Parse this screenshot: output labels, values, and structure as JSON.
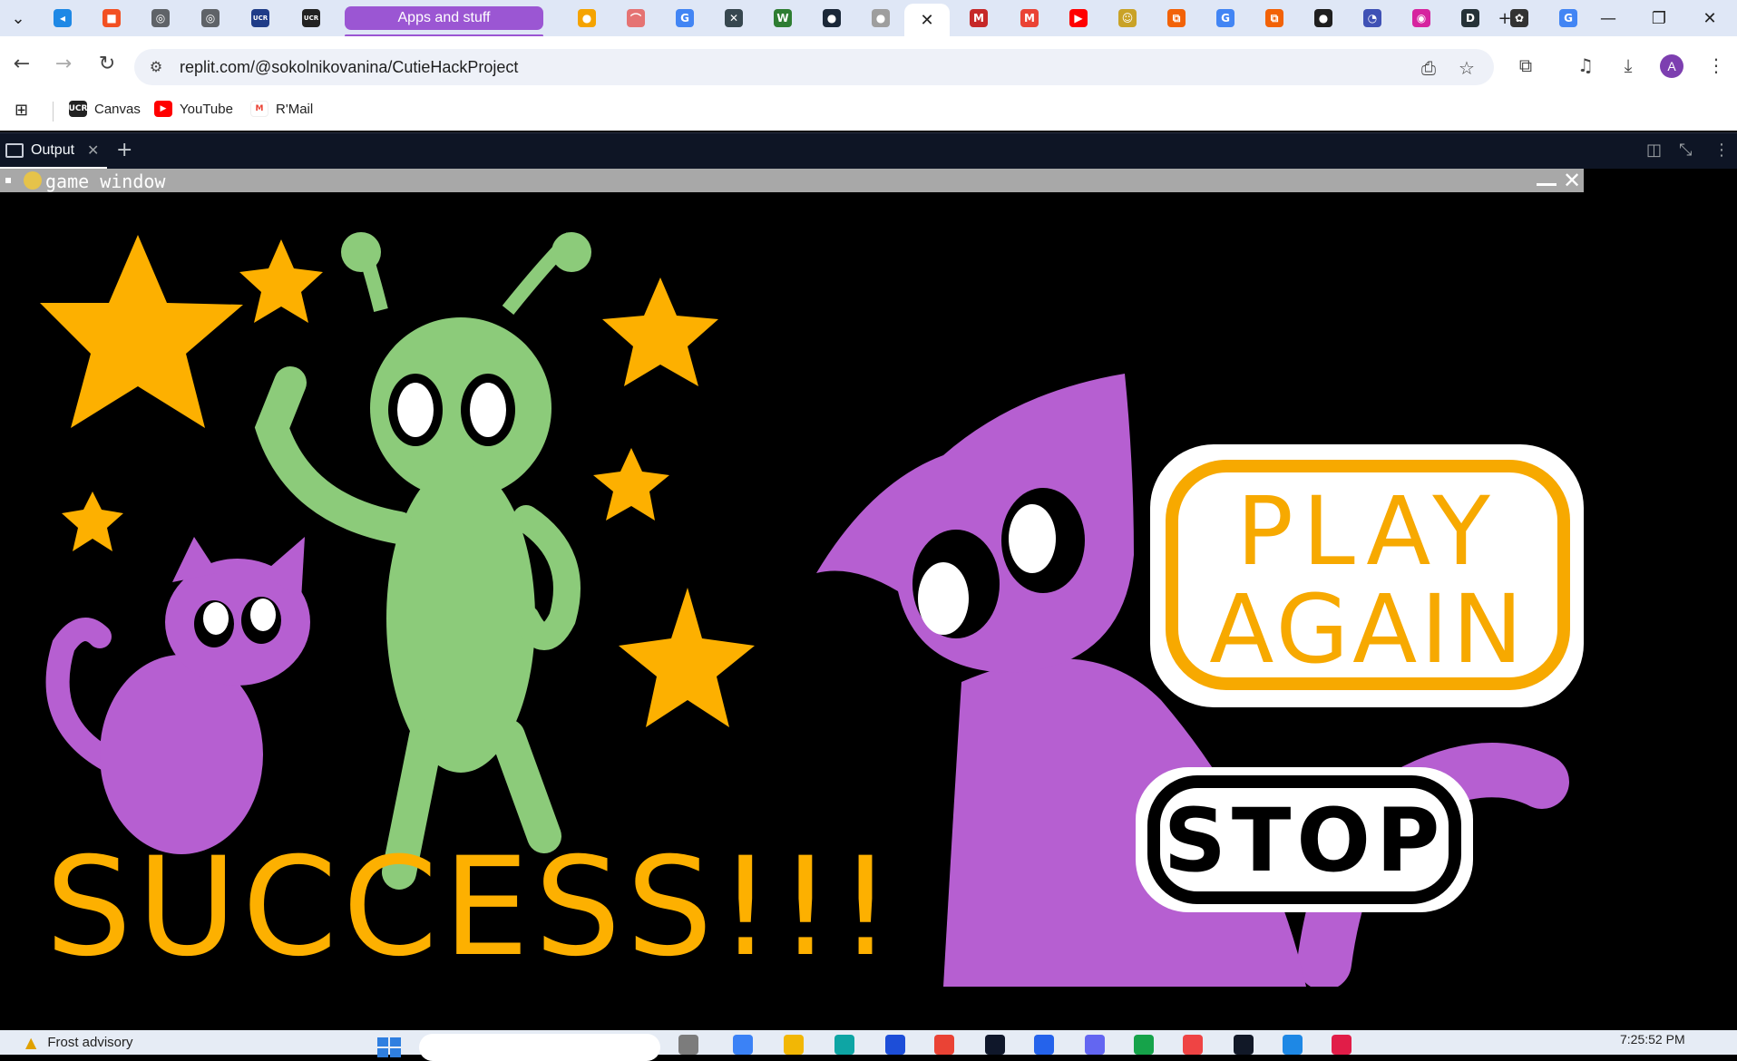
{
  "browser": {
    "tab_group_label": "Apps and stuff",
    "tabs": [
      {
        "icon": "vscode-icon",
        "color": "#1e88e5",
        "glyph": "◂"
      },
      {
        "icon": "microsoft-icon",
        "color": "#f25022",
        "glyph": "■"
      },
      {
        "icon": "chrome-icon",
        "color": "#5f6368",
        "glyph": "◎"
      },
      {
        "icon": "chrome-icon",
        "color": "#5f6368",
        "glyph": "◎"
      },
      {
        "icon": "ucr-icon",
        "color": "#1f3c88",
        "glyph": "UCR"
      },
      {
        "icon": "ucr-learn-icon",
        "color": "#222222",
        "glyph": "UCR"
      },
      {
        "icon": "orange-circle-icon",
        "color": "#f5a300",
        "glyph": "●"
      },
      {
        "icon": "rainbow-icon",
        "color": "#e57373",
        "glyph": "⌒"
      },
      {
        "icon": "google-icon",
        "color": "#4285f4",
        "glyph": "G"
      },
      {
        "icon": "graph-icon",
        "color": "#37474f",
        "glyph": "✕"
      },
      {
        "icon": "w-icon",
        "color": "#2e7d32",
        "glyph": "W"
      },
      {
        "icon": "steam-icon",
        "color": "#1b2838",
        "glyph": "●"
      },
      {
        "icon": "globe-icon",
        "color": "#9e9e9e",
        "glyph": "●"
      },
      {
        "icon": "mcafee-icon",
        "color": "#c62828",
        "glyph": "M"
      },
      {
        "icon": "gmail-icon",
        "color": "#ea4335",
        "glyph": "M"
      },
      {
        "icon": "youtube-icon",
        "color": "#ff0000",
        "glyph": "▶"
      },
      {
        "icon": "character-icon",
        "color": "#c9a227",
        "glyph": "☺"
      },
      {
        "icon": "replit-icon",
        "color": "#f26207",
        "glyph": "⧉"
      },
      {
        "icon": "google-icon",
        "color": "#4285f4",
        "glyph": "G"
      },
      {
        "icon": "replit-icon",
        "color": "#f26207",
        "glyph": "⧉"
      },
      {
        "icon": "github-icon",
        "color": "#1f1f1f",
        "glyph": "●"
      },
      {
        "icon": "clock-icon",
        "color": "#3f51b5",
        "glyph": "◔"
      },
      {
        "icon": "instagram-icon",
        "color": "#d6249f",
        "glyph": "◉"
      },
      {
        "icon": "d-icon",
        "color": "#263238",
        "glyph": "D"
      },
      {
        "icon": "chatgpt-icon",
        "color": "#333333",
        "glyph": "✿"
      },
      {
        "icon": "google-icon",
        "color": "#4285f4",
        "glyph": "G"
      }
    ],
    "url": "replit.com/@sokolnikovanina/CutieHackProject",
    "avatar_letter": "A",
    "bookmarks": [
      {
        "label": "Canvas",
        "icon": "ucr-learn-icon"
      },
      {
        "label": "YouTube",
        "icon": "youtube-icon"
      },
      {
        "label": "R'Mail",
        "icon": "gmail-icon"
      }
    ]
  },
  "replit": {
    "pane_tab_label": "Output",
    "game_window_title": "game window"
  },
  "game": {
    "headline": "SUCCESS!!!",
    "play_again_line1": "PLAY",
    "play_again_line2": "AGAIN",
    "stop_label": "STOP",
    "colors": {
      "star": "#fdb000",
      "alien": "#8ccb7a",
      "cat": "#b65fd1",
      "button_bg": "#ffffff",
      "play_outline": "#f7a900",
      "stop_outline": "#000000"
    }
  },
  "taskbar": {
    "weather_text": "Frost advisory",
    "clock": "7:25:52 PM"
  }
}
